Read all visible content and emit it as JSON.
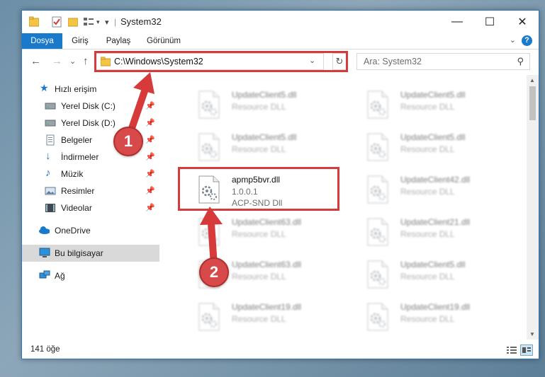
{
  "titlebar": {
    "title": "System32",
    "qa_icons": [
      "folder-icon",
      "properties-icon",
      "new-folder-icon",
      "view-menu-icon",
      "dropdown-icon"
    ],
    "minimize": "—",
    "maximize": "☐",
    "close": "✕"
  },
  "ribbon": {
    "tabs": [
      {
        "label": "Dosya",
        "active": true
      },
      {
        "label": "Giriş"
      },
      {
        "label": "Paylaş"
      },
      {
        "label": "Görünüm"
      }
    ],
    "expand_icon": "⌄",
    "help_label": "?"
  },
  "navigation": {
    "back": "←",
    "forward": "→",
    "recent": "⌄",
    "up": "↑",
    "address": "C:\\Windows\\System32",
    "address_dropdown": "⌄",
    "refresh": "↻",
    "search_placeholder": "Ara: System32",
    "search_icon": "⚲"
  },
  "sidebar": {
    "quick_access": "Hızlı erişim",
    "items": [
      {
        "label": "Yerel Disk (C:)",
        "icon": "drive-icon",
        "pinned": true
      },
      {
        "label": "Yerel Disk (D:)",
        "icon": "drive-icon",
        "pinned": true
      },
      {
        "label": "Belgeler",
        "icon": "documents-icon",
        "pinned": true
      },
      {
        "label": "İndirmeler",
        "icon": "downloads-icon",
        "pinned": true
      },
      {
        "label": "Müzik",
        "icon": "music-icon",
        "pinned": true
      },
      {
        "label": "Resimler",
        "icon": "pictures-icon",
        "pinned": true
      },
      {
        "label": "Videolar",
        "icon": "videos-icon",
        "pinned": true
      }
    ],
    "onedrive": "OneDrive",
    "this_pc": "Bu bilgisayar",
    "network": "Ağ",
    "pin_glyph": "📌"
  },
  "files": [
    {
      "name": "UpdateClient5.dll",
      "desc": "Resource DLL",
      "blurred": true
    },
    {
      "name": "UpdateClient5.dll",
      "desc": "Resource DLL",
      "blurred": true
    },
    {
      "name": "UpdateClient5.dll",
      "desc": "Resource DLL",
      "blurred": true
    },
    {
      "name": "UpdateClient5.dll",
      "desc": "Resource DLL",
      "blurred": true
    },
    {
      "name": "apmp5bvr.dll",
      "version": "1.0.0.1",
      "desc": "ACP-SND Dll",
      "blurred": false
    },
    {
      "name": "UpdateClient42.dll",
      "desc": "Resource DLL",
      "blurred": true
    },
    {
      "name": "UpdateClient63.dll",
      "desc": "Resource DLL",
      "blurred": true
    },
    {
      "name": "UpdateClient21.dll",
      "desc": "Resource DLL",
      "blurred": true
    },
    {
      "name": "UpdateClient63.dll",
      "desc": "Resource DLL",
      "blurred": true
    },
    {
      "name": "UpdateClient5.dll",
      "desc": "Resource DLL",
      "blurred": true
    },
    {
      "name": "UpdateClient19.dll",
      "desc": "Resource DLL",
      "blurred": true
    },
    {
      "name": "UpdateClient19.dll",
      "desc": "Resource DLL",
      "blurred": true
    }
  ],
  "status": {
    "count": "141 öğe"
  },
  "annotations": {
    "step1": "1",
    "step2": "2",
    "color": "#d63a3a"
  }
}
